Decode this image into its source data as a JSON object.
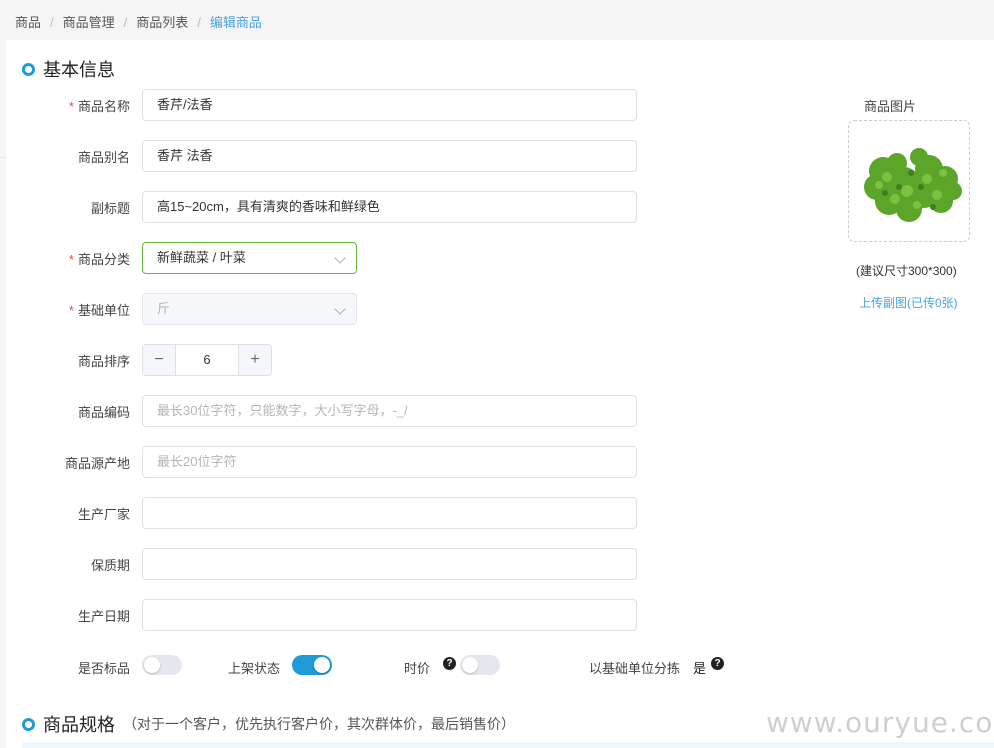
{
  "breadcrumb": [
    "商品",
    "商品管理",
    "商品列表",
    "编辑商品"
  ],
  "sections": {
    "basic": "基本信息",
    "spec": "商品规格",
    "spec_note": "（对于一个客户，优先执行客户价，其次群体价，最后销售价）"
  },
  "form": {
    "name": {
      "label": "商品名称",
      "value": "香芹/法香",
      "required": true
    },
    "alias": {
      "label": "商品别名",
      "value": "香芹 法香"
    },
    "subtitle": {
      "label": "副标题",
      "value": "高15~20cm，具有清爽的香味和鲜绿色"
    },
    "category": {
      "label": "商品分类",
      "value": "新鲜蔬菜 / 叶菜",
      "required": true
    },
    "unit": {
      "label": "基础单位",
      "value": "斤",
      "required": true
    },
    "sort": {
      "label": "商品排序",
      "value": "6",
      "minus": "−",
      "plus": "+"
    },
    "code": {
      "label": "商品编码",
      "placeholder": "最长30位字符，只能数字，大小写字母，-_/"
    },
    "origin": {
      "label": "商品源产地",
      "placeholder": "最长20位字符"
    },
    "manufacturer": {
      "label": "生产厂家",
      "value": ""
    },
    "shelf_life": {
      "label": "保质期",
      "value": ""
    },
    "production_date": {
      "label": "生产日期",
      "value": ""
    }
  },
  "toggles": {
    "standard": {
      "label": "是否标品",
      "on": false
    },
    "listed": {
      "label": "上架状态",
      "on": true
    },
    "market_price": {
      "label": "时价",
      "on": false
    },
    "sort_by_base_unit": {
      "label": "以基础单位分拣",
      "value": "是"
    }
  },
  "image_panel": {
    "title": "商品图片",
    "hint": "(建议尺寸300*300)",
    "upload_link": "上传副图(已传0张)"
  },
  "watermark": "www.ouryue.com",
  "colors": {
    "accent": "#1e9bd7",
    "link": "#4aa3df",
    "required": "#e74c3c",
    "active_border": "#67b83a"
  },
  "icons": {
    "required": "asterisk-icon",
    "help": "question-circle-icon",
    "section": "ring-icon",
    "dropdown": "chevron-down-icon"
  }
}
